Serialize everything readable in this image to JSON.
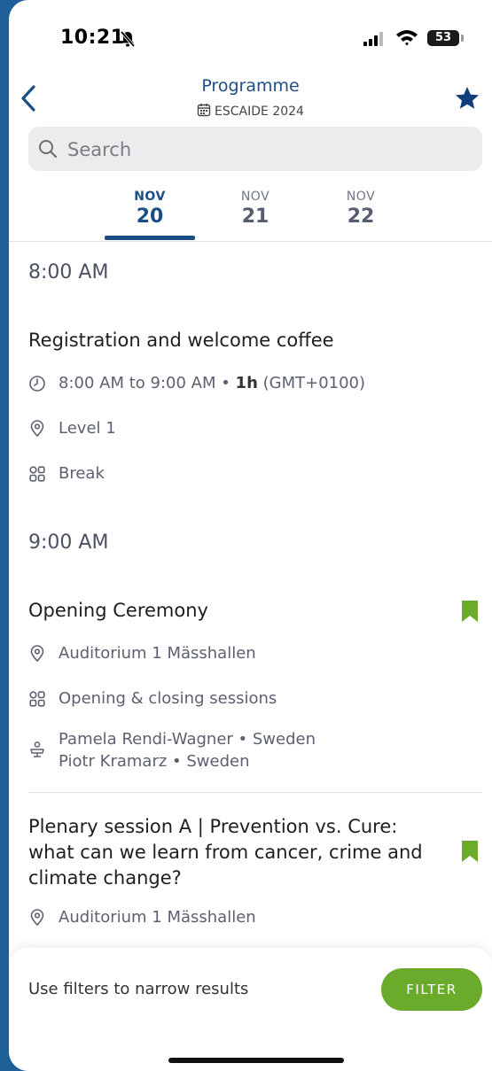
{
  "status": {
    "time": "10:21",
    "battery": "53"
  },
  "nav": {
    "title": "Programme",
    "subtitle": "ESCAIDE 2024"
  },
  "search": {
    "placeholder": "Search"
  },
  "tabs": [
    {
      "month": "NOV",
      "day": "20"
    },
    {
      "month": "NOV",
      "day": "21"
    },
    {
      "month": "NOV",
      "day": "22"
    }
  ],
  "blocks": [
    {
      "time": "8:00 AM"
    },
    {
      "time": "9:00 AM"
    }
  ],
  "sessions": {
    "registration": {
      "title": "Registration and welcome coffee",
      "time_range": "8:00 AM to 9:00 AM • ",
      "duration": "1h",
      "timezone": " (GMT+0100)",
      "location": "Level 1",
      "category": "Break"
    },
    "opening": {
      "title": "Opening Ceremony",
      "location": "Auditorium 1 Mässhallen",
      "category": "Opening & closing sessions",
      "speaker1": "Pamela Rendi-Wagner • Sweden",
      "speaker2": "Piotr Kramarz • Sweden"
    },
    "plenary": {
      "title": "Plenary session A | Prevention vs. Cure: what can we learn from cancer, crime and climate change?",
      "location": "Auditorium 1 Mässhallen"
    }
  },
  "footer": {
    "hint": "Use filters to narrow results",
    "filter_label": "FILTER"
  },
  "colors": {
    "primary": "#1b4e86",
    "accent": "#6aab2c"
  }
}
